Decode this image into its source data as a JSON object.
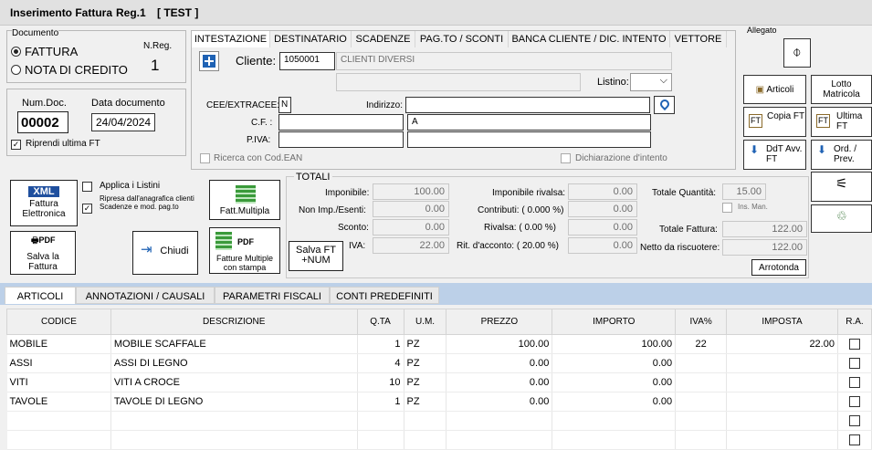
{
  "title": {
    "window": "Inserimento Fattura",
    "reg": "Reg.1",
    "mode": "[ TEST ]"
  },
  "documento": {
    "label": "Documento",
    "nreg_label": "N.Reg.",
    "nreg_value": "1",
    "opt_fattura": "FATTURA",
    "opt_nota": "NOTA DI CREDITO"
  },
  "numdoc": {
    "label": "Num.Doc.",
    "value": "00002",
    "date_label": "Data documento",
    "date_value": "24/04/2024",
    "riprendi": "Riprendi ultima FT"
  },
  "tabs": [
    "INTESTAZIONE",
    "DESTINATARIO",
    "SCADENZE",
    "PAG.TO / SCONTI",
    "BANCA CLIENTE  / DIC. INTENTO",
    "VETTORE"
  ],
  "cliente": {
    "label": "Cliente:",
    "code": "1050001",
    "name": "CLIENTI DIVERSI",
    "listino_label": "Listino:",
    "cee_label": "CEE/EXTRACEE:",
    "cee_value": "N",
    "indirizzo_label": "Indirizzo:",
    "cf_label": "C.F. :",
    "citta": "A",
    "piva_label": "P.IVA:",
    "ricerca_ean": "Ricerca con Cod.EAN",
    "dich_intento": "Dichiarazione d'intento"
  },
  "allegato": {
    "label": "Allegato"
  },
  "side_buttons": {
    "articoli": "Articoli",
    "lotto": "Lotto Matricola",
    "copia_ft": "Copia FT",
    "ultima_ft": "Ultima FT",
    "ddt": "DdT Avv. FT",
    "ord_prev": "Ord. / Prev."
  },
  "left_buttons": {
    "xml": "XML",
    "fattura_elettronica": "Fattura Elettronica",
    "applica_listini": "Applica i Listini",
    "ripresa": "Ripresa dall'anagrafica clienti Scadenze e mod. pag.to",
    "fatt_multipla": "Fatt.Multipla",
    "salva_fattura": "Salva la Fattura",
    "chiudi": "Chiudi",
    "fatture_multiple": "Fatture Multiple con stampa",
    "salva_ft_num": "Salva FT +NUM",
    "pdf": "PDF"
  },
  "totali": {
    "label": "TOTALI",
    "imponibile_label": "Imponibile:",
    "imponibile": "100.00",
    "nonimp_label": "Non Imp./Esenti:",
    "nonimp": "0.00",
    "sconto_label": "Sconto:",
    "sconto": "0.00",
    "iva_label": "IVA:",
    "iva": "22.00",
    "imp_rivalsa_label": "Imponibile rivalsa:",
    "imp_rivalsa": "0.00",
    "contributi_label": "Contributi:  ( 0.000 %)",
    "contributi": "0.00",
    "rivalsa_label": "Rivalsa:  ( 0.00 %)",
    "rivalsa": "0.00",
    "ritenuta_label": "Rit. d'acconto: ( 20.00 %)",
    "ritenuta": "0.00",
    "tot_qta_label": "Totale Quantità:",
    "tot_qta": "15.00",
    "ins_man": "Ins. Man.",
    "tot_fattura_label": "Totale Fattura:",
    "tot_fattura": "122.00",
    "netto_label": "Netto da riscuotere:",
    "netto": "122.00",
    "arrotonda": "Arrotonda"
  },
  "bottom_tabs": [
    "ARTICOLI",
    "ANNOTAZIONI  / CAUSALI",
    "PARAMETRI FISCALI",
    "CONTI PREDEFINITI"
  ],
  "grid": {
    "headers": [
      "CODICE",
      "DESCRIZIONE",
      "Q.TA",
      "U.M.",
      "PREZZO",
      "IMPORTO",
      "IVA%",
      "IMPOSTA",
      "R.A."
    ],
    "rows": [
      [
        "MOBILE",
        "MOBILE SCAFFALE",
        "1",
        "PZ",
        "100.00",
        "100.00",
        "22",
        "22.00"
      ],
      [
        "ASSI",
        "ASSI DI LEGNO",
        "4",
        "PZ",
        "0.00",
        "0.00",
        "",
        ""
      ],
      [
        "VITI",
        "VITI A CROCE",
        "10",
        "PZ",
        "0.00",
        "0.00",
        "",
        ""
      ],
      [
        "TAVOLE",
        "TAVOLE DI LEGNO",
        "1",
        "PZ",
        "0.00",
        "0.00",
        "",
        ""
      ],
      [
        "",
        "",
        "",
        "",
        "",
        "",
        "",
        ""
      ],
      [
        "",
        "",
        "",
        "",
        "",
        "",
        "",
        ""
      ]
    ]
  }
}
